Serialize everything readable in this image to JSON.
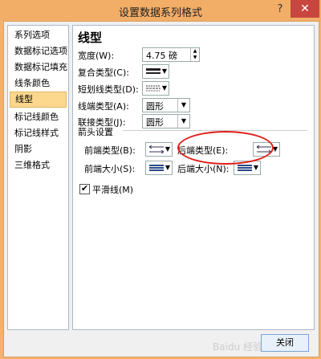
{
  "window": {
    "title": "设置数据系列格式",
    "help": "?",
    "close": "✕"
  },
  "sidebar": {
    "items": [
      {
        "label": "系列选项"
      },
      {
        "label": "数据标记选项"
      },
      {
        "label": "数据标记填充"
      },
      {
        "label": "线条颜色"
      },
      {
        "label": "线型"
      },
      {
        "label": "标记线颜色"
      },
      {
        "label": "标记线样式"
      },
      {
        "label": "阴影"
      },
      {
        "label": "三维格式"
      }
    ],
    "active_index": 4
  },
  "panel": {
    "title": "线型",
    "width_label": "宽度(W):",
    "width_value": "4.75 磅",
    "compound_label": "复合类型(C):",
    "dash_label": "短划线类型(D):",
    "cap_label": "线端类型(A):",
    "cap_value": "圆形",
    "join_label": "联接类型(J):",
    "join_value": "圆形",
    "arrow_section": "箭头设置",
    "begin_type_label": "前端类型(B):",
    "end_type_label": "后端类型(E):",
    "begin_size_label": "前端大小(S):",
    "end_size_label": "后端大小(N):",
    "smooth_label": "平滑线(M)",
    "smooth_checked": "✔"
  },
  "footer": {
    "close_label": "关闭",
    "watermark": "Baidu 经验"
  },
  "colors": {
    "accent": "#f4b170",
    "highlight": "#e0201a"
  }
}
